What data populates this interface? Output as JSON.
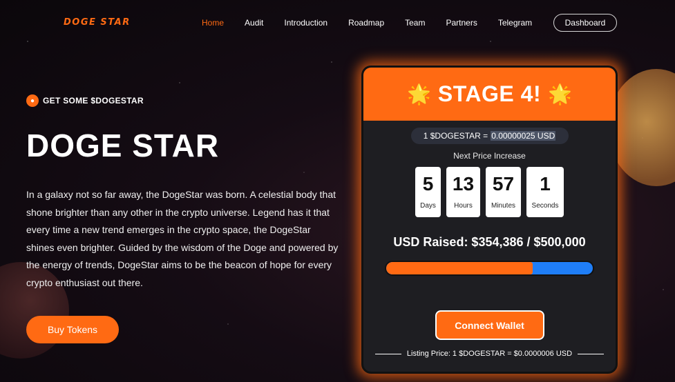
{
  "nav": {
    "logo": "DOGE STAR",
    "links": [
      "Home",
      "Audit",
      "Introduction",
      "Roadmap",
      "Team",
      "Partners",
      "Telegram"
    ],
    "active": "Home",
    "dashboard_label": "Dashboard"
  },
  "hero": {
    "tagline": "GET SOME $DOGESTAR",
    "title": "DOGE STAR",
    "description": "In a galaxy not so far away, the DogeStar was born. A celestial body that shone brighter than any other in the crypto universe. Legend has it that every time a new trend emerges in the crypto space, the DogeStar shines even brighter. Guided by the wisdom of the Doge and powered by the energy of trends, DogeStar aims to be the beacon of hope for every crypto enthusiast out there.",
    "buy_label": "Buy Tokens"
  },
  "presale": {
    "stage_title": "STAGE 4!",
    "star_icon": "🌟",
    "price_prefix": "1 $DOGESTAR =",
    "price_value": "0.00000025 USD",
    "next_label": "Next Price Increase",
    "countdown": [
      {
        "value": "5",
        "label": "Days"
      },
      {
        "value": "13",
        "label": "Hours"
      },
      {
        "value": "57",
        "label": "Minutes"
      },
      {
        "value": "1",
        "label": "Seconds"
      }
    ],
    "raised_text": "USD Raised: $354,386 / $500,000",
    "progress_fraction": 0.71,
    "connect_label": "Connect Wallet",
    "listing_text": "Listing Price: 1 $DOGESTAR = $0.0000006 USD"
  },
  "colors": {
    "accent": "#ff6a13",
    "progress_remaining": "#1f7ef7"
  }
}
